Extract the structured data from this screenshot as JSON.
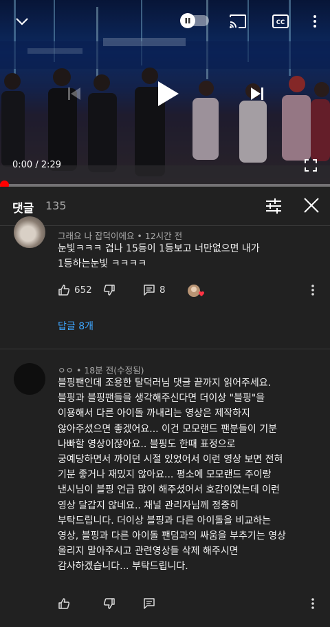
{
  "video": {
    "time_display": "0:00 / 2:29",
    "progress": 0.0,
    "accent_color": "#ff0000"
  },
  "comments_panel": {
    "title": "댓글",
    "count": "135"
  },
  "comments": [
    {
      "meta": "그래요 나 잡덕이에요 • 12시간 전",
      "text": "눈빛ㅋㅋㅋ 겁나 15등이 1등보고 너만없으면 내가\n1등하는눈빛 ㅋㅋㅋㅋ",
      "likes": "652",
      "reply_count": "8",
      "replies_link": "답글 8개"
    },
    {
      "meta": "ㅇㅇ • 18분 전(수정됨)",
      "text": "블핑팬인데 조용한 탈덕러님 댓글 끝까지 읽어주세요.\n블핑과 블핑팬들을 생각해주신다면 더이상 \"블핑\"을\n이용해서 다른 아이돌 까내리는 영상은 제작하지\n않아주셨으면 좋겠어요... 이건 모모랜드 팬분들이 기분\n나빠할 영상이잖아요.. 블핑도 한때 표정으로\n궁예당하면서 까이던 시절 있었어서 이런 영상 보면 전혀\n기분 좋거나 재밌지 않아요... 평소에 모모랜드 주이랑\n낸시님이 블핑 언급 많이 해주셨어서 호감이였는데 이런\n영상 달갑지 않네요.. 채널 관리자님께 정중히\n부탁드립니다. 더이상 블핑과 다른 아이돌을 비교하는\n영상, 블핑과 다른 아이돌 팬덤과의 싸움을 부추기는 영상\n올리지 말아주시고 관련영상들 삭제 해주시면\n감사하겠습니다... 부탁드립니다."
    }
  ],
  "icons": {
    "collapse": "chevron-down-icon",
    "autoplay": "autoplay-toggle-icon",
    "cast": "cast-icon",
    "captions": "captions-icon",
    "more": "more-vert-icon",
    "previous": "skip-previous-icon",
    "play": "play-icon",
    "next": "skip-next-icon",
    "fullscreen": "fullscreen-icon",
    "filter": "sort-filter-icon",
    "close": "close-icon",
    "like": "thumb-up-icon",
    "dislike": "thumb-down-icon",
    "reply": "comment-icon",
    "creator_heart": "creator-heart-icon"
  }
}
